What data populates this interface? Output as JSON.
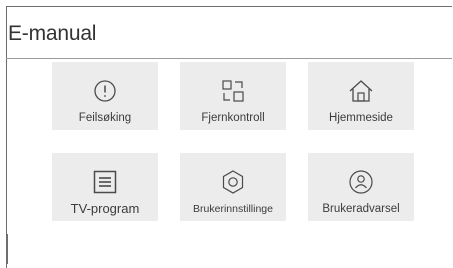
{
  "header": {
    "title": "E-manual"
  },
  "tiles": [
    {
      "label": "Feilsøking",
      "icon": "exclamation-circle-icon"
    },
    {
      "label": "Fjernkontroll",
      "icon": "remote-grid-icon"
    },
    {
      "label": "Hjemmeside",
      "icon": "home-icon"
    },
    {
      "label": "TV-program",
      "icon": "list-icon"
    },
    {
      "label": "Brukerinnstillinge",
      "icon": "settings-hexagon-icon"
    },
    {
      "label": "Brukeradvarsel",
      "icon": "user-circle-icon"
    }
  ],
  "colors": {
    "tile_background": "#ececec",
    "icon_stroke": "#4a4a4a",
    "text": "#3c3c3c"
  }
}
